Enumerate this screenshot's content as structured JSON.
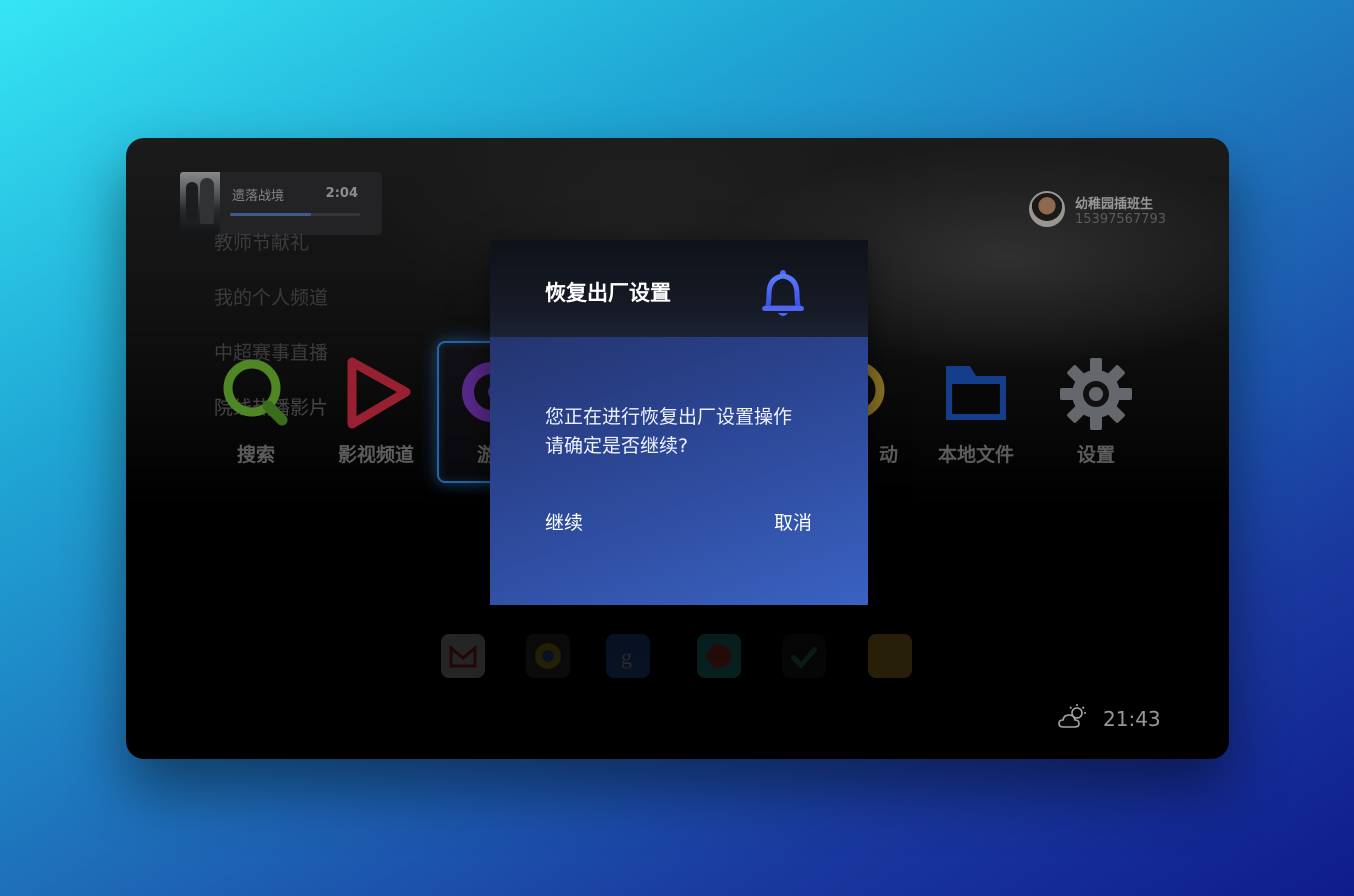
{
  "now_playing": {
    "title": "遗落战境",
    "time": "2:04",
    "progress": 0.62
  },
  "side_menu": {
    "items": [
      "教师节献礼",
      "我的个人频道",
      "中超赛事直播",
      "院线热播影片"
    ]
  },
  "user": {
    "name": "幼稚园插班生",
    "phone": "15397567793"
  },
  "apps": [
    {
      "label": "搜索",
      "icon": "search-icon",
      "color": "#7ccf3a"
    },
    {
      "label": "影视频道",
      "icon": "play-icon",
      "color": "#e8344a"
    },
    {
      "label": "游戏",
      "icon": "gamepad-icon",
      "color": "#8a3fd6",
      "focused": true
    },
    {
      "label": "",
      "icon": "tv-icon",
      "color": "#3a5fbf"
    },
    {
      "label": "",
      "icon": "grid-icon",
      "color": "#3a5fbf"
    },
    {
      "label": "动",
      "icon": "activity-icon",
      "color": "#d9b23a"
    },
    {
      "label": "本地文件",
      "icon": "folder-icon",
      "color": "#1f5fd6"
    },
    {
      "label": "设置",
      "icon": "gear-icon",
      "color": "#9aa0a8"
    }
  ],
  "dock": [
    {
      "icon": "gmail-icon",
      "color": "#dcdcdc"
    },
    {
      "icon": "chrome-icon",
      "color": "#e0c030"
    },
    {
      "icon": "google-icon",
      "color": "#3a6fd8"
    },
    {
      "icon": "podcast-icon",
      "color": "#2ec4b6"
    },
    {
      "icon": "check-icon",
      "color": "#3cb371"
    },
    {
      "icon": "notes-icon",
      "color": "#f2c230"
    }
  ],
  "status": {
    "weather_icon": "partly-cloudy-icon",
    "time": "21:43"
  },
  "dialog": {
    "title": "恢复出厂设置",
    "icon": "bell-icon",
    "message_line1": "您正在进行恢复出厂设置操作",
    "message_line2": "请确定是否继续?",
    "continue_label": "继续",
    "cancel_label": "取消"
  }
}
